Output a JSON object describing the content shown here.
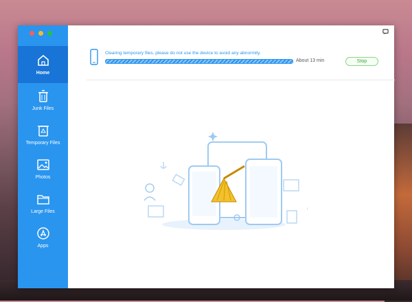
{
  "sidebar": {
    "items": [
      {
        "label": "Home",
        "icon": "home-icon",
        "active": true
      },
      {
        "label": "Junk Files",
        "icon": "trash-icon",
        "active": false
      },
      {
        "label": "Temporary Files",
        "icon": "recycle-bin-icon",
        "active": false
      },
      {
        "label": "Photos",
        "icon": "photo-icon",
        "active": false
      },
      {
        "label": "Large Files",
        "icon": "folder-icon",
        "active": false
      },
      {
        "label": "Apps",
        "icon": "app-store-icon",
        "active": false
      }
    ]
  },
  "progress": {
    "status_text": "Clearing temporary files, please do not use the device to avoid any abnormity.",
    "eta": "About 13 min",
    "stop_label": "Stop"
  },
  "colors": {
    "accent": "#2a95ef",
    "active": "#1874d6",
    "stop": "#3aa83a"
  }
}
